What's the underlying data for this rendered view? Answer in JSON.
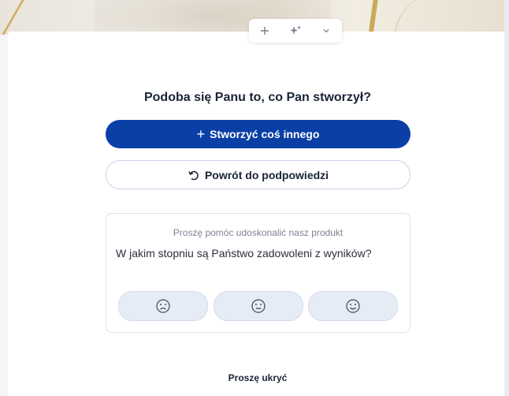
{
  "toolbar": {
    "icons": [
      "plus-icon",
      "sparkle-plus-icon",
      "chevron-down-icon"
    ]
  },
  "heading": "Podoba się Panu to, co Pan stworzył?",
  "primary_button": {
    "icon": "plus-icon",
    "label": "Stworzyć coś innego"
  },
  "secondary_button": {
    "icon": "undo-arrow-icon",
    "label": "Powrót do podpowiedzi"
  },
  "feedback": {
    "subtitle": "Proszę pomóc udoskonalić nasz produkt",
    "question": "W jakim stopniu są Państwo zadowoleni z wyników?",
    "ratings": [
      "sad-face-icon",
      "neutral-face-icon",
      "happy-face-icon"
    ]
  },
  "hide_label": "Proszę ukryć",
  "colors": {
    "primary": "#0a3fa6",
    "text": "#1b2337",
    "muted": "#7c8393"
  }
}
